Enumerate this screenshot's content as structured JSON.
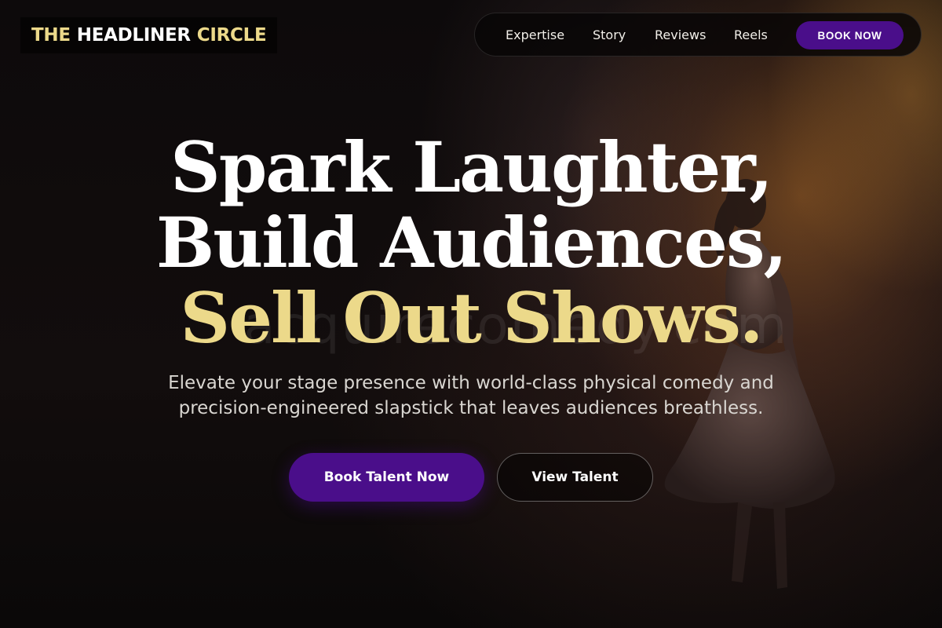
{
  "brand": {
    "word1": "THE",
    "word2": "HEADLINER",
    "word3": "CIRCLE"
  },
  "nav": {
    "items": [
      {
        "label": "Expertise"
      },
      {
        "label": "Story"
      },
      {
        "label": "Reviews"
      },
      {
        "label": "Reels"
      }
    ],
    "cta_label": "BOOK NOW"
  },
  "hero": {
    "headline_line1": "Spark Laughter,",
    "headline_line2": "Build Audiences,",
    "headline_line3": "Sell Out Shows.",
    "subtitle_line1": "Elevate your stage presence with world-class physical comedy and",
    "subtitle_line2": "precision-engineered slapstick that leaves audiences breathless.",
    "primary_button": "Book Talent Now",
    "secondary_button": "View Talent",
    "watermark_text": "acquirecomedy.com"
  },
  "colors": {
    "accent_purple": "#4a0e8a",
    "accent_gold": "#ecd98a",
    "background": "#0b0809"
  },
  "icons": {
    "performer": "dancer-silhouette"
  }
}
